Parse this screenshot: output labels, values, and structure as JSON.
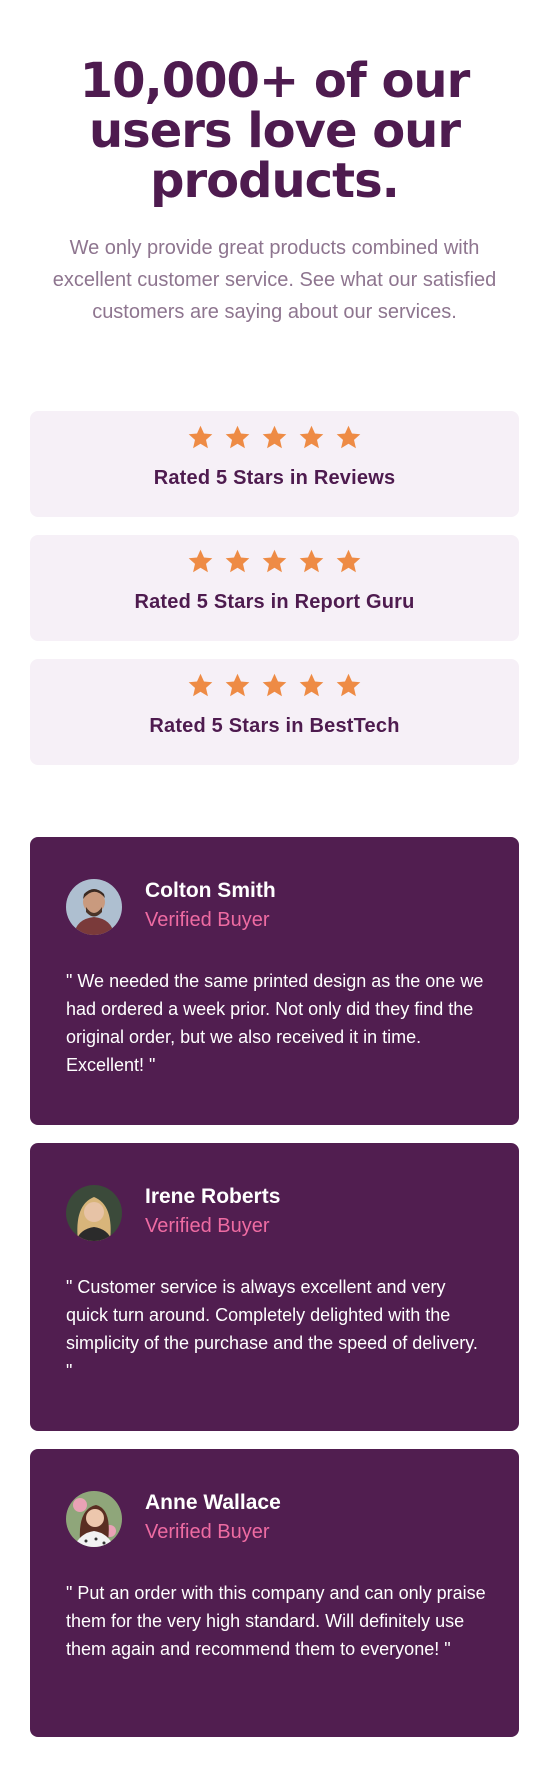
{
  "hero": {
    "title": "10,000+ of our users love our products.",
    "description": "We only provide great products combined with excellent customer service. See what our satisfied customers are saying about our services."
  },
  "ratings": [
    {
      "label": "Rated 5 Stars in Reviews",
      "stars": 5
    },
    {
      "label": "Rated 5 Stars in Report Guru",
      "stars": 5
    },
    {
      "label": "Rated 5 Stars in BestTech",
      "stars": 5
    }
  ],
  "testimonials": [
    {
      "name": "Colton Smith",
      "badge": "Verified Buyer",
      "quote": "\" We needed the same printed design as the one we had ordered a week prior. Not only did they find the original order, but we also received it in time. Excellent! \""
    },
    {
      "name": "Irene Roberts",
      "badge": "Verified Buyer",
      "quote": "\" Customer service is always excellent and very quick turn around. Completely delighted with the simplicity of the purchase and the speed of delivery. \""
    },
    {
      "name": "Anne Wallace",
      "badge": "Verified Buyer",
      "quote": "\" Put an order with this company and can only praise them for the very high standard. Will definitely use them again and recommend them to everyone! \""
    }
  ],
  "colors": {
    "primary": "#4e1b4f",
    "card_bg": "#511e50",
    "rating_bg": "#f6f0f7",
    "star": "#ee8b45",
    "accent_pink": "#ee6ba2",
    "muted_text": "#8e758f"
  }
}
